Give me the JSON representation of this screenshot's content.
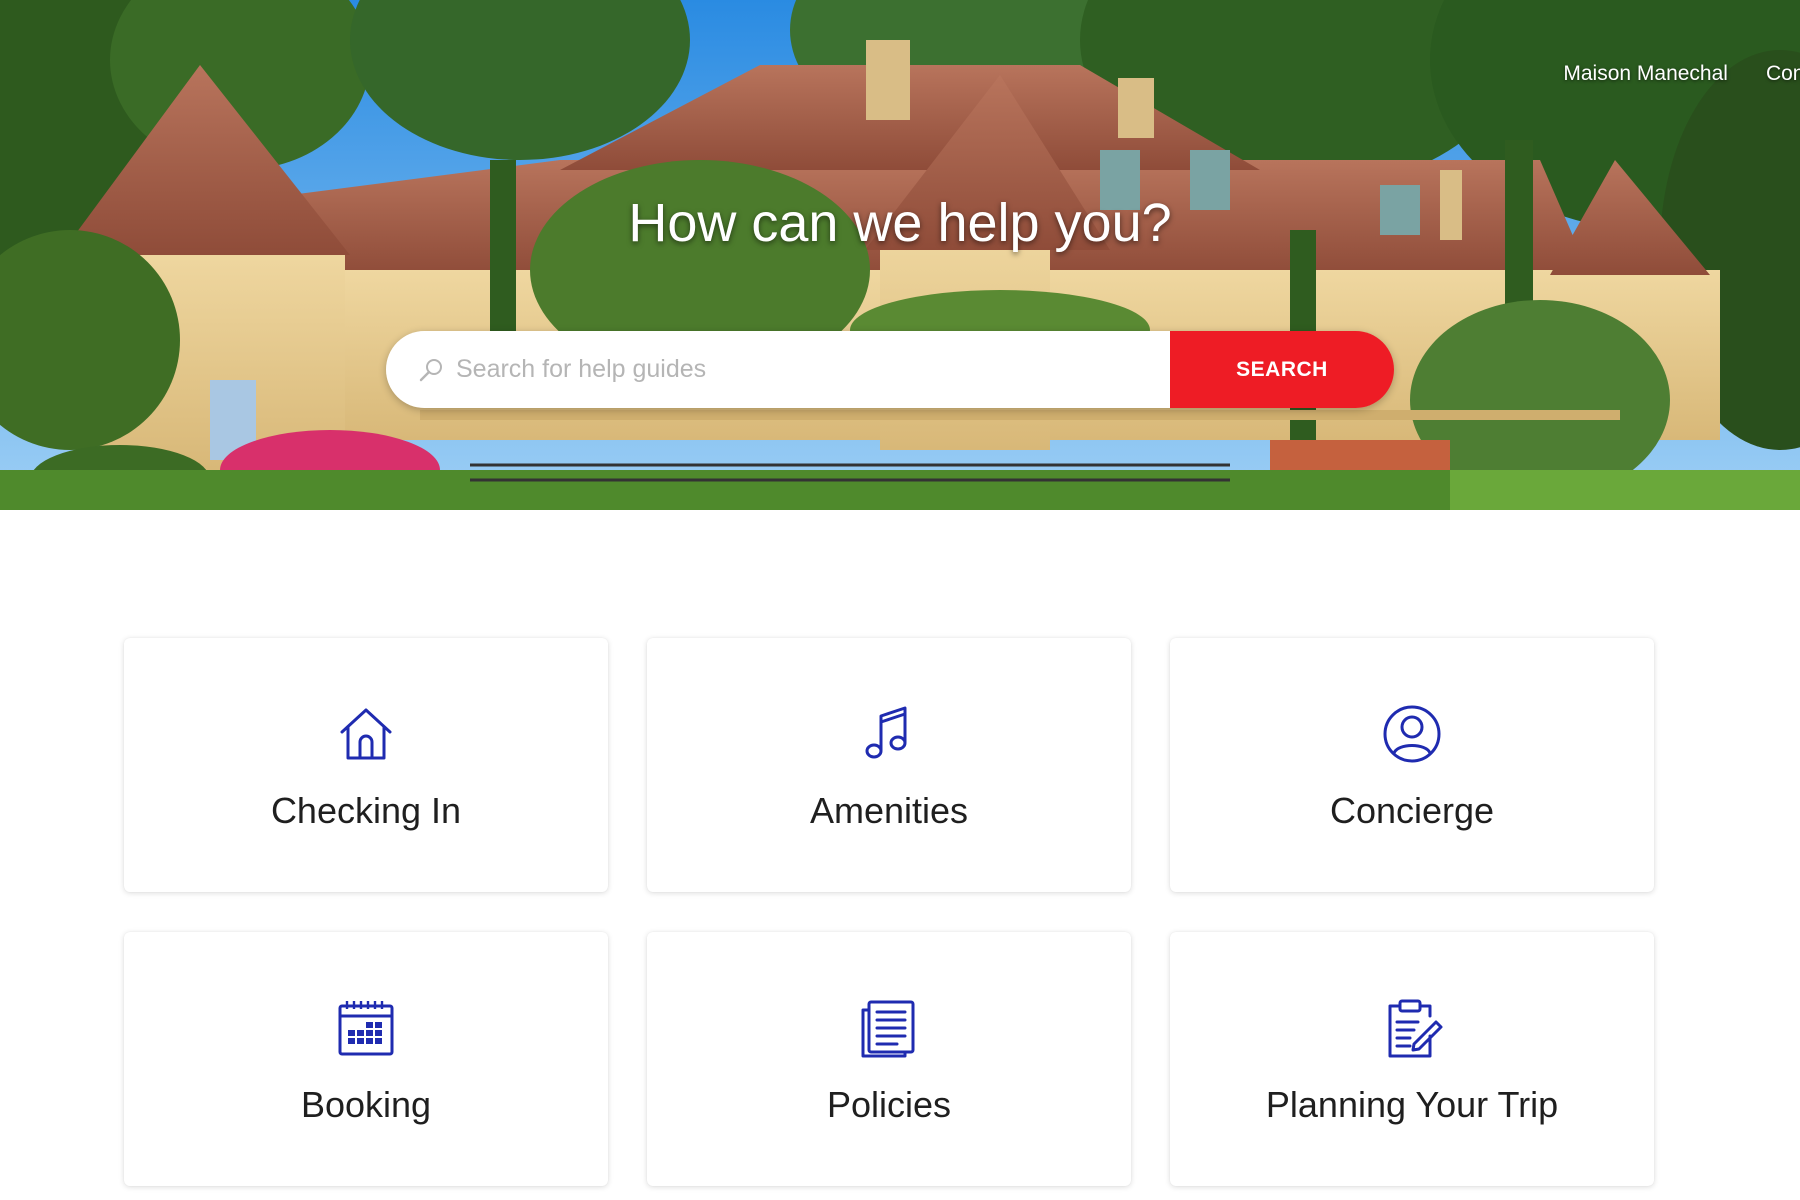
{
  "nav": {
    "links": [
      "Maison Manechal",
      "Conta"
    ]
  },
  "hero": {
    "title": "How can we help you?"
  },
  "search": {
    "placeholder": "Search for help guides",
    "button_label": "SEARCH"
  },
  "categories": [
    {
      "label": "Checking In",
      "icon": "house-icon"
    },
    {
      "label": "Amenities",
      "icon": "music-note-icon"
    },
    {
      "label": "Concierge",
      "icon": "user-circle-icon"
    },
    {
      "label": "Booking",
      "icon": "calendar-icon"
    },
    {
      "label": "Policies",
      "icon": "document-icon"
    },
    {
      "label": "Planning Your Trip",
      "icon": "clipboard-edit-icon"
    }
  ],
  "colors": {
    "accent": "#ee1c25",
    "icon": "#1f2bb0",
    "text": "#1f1f1f"
  }
}
